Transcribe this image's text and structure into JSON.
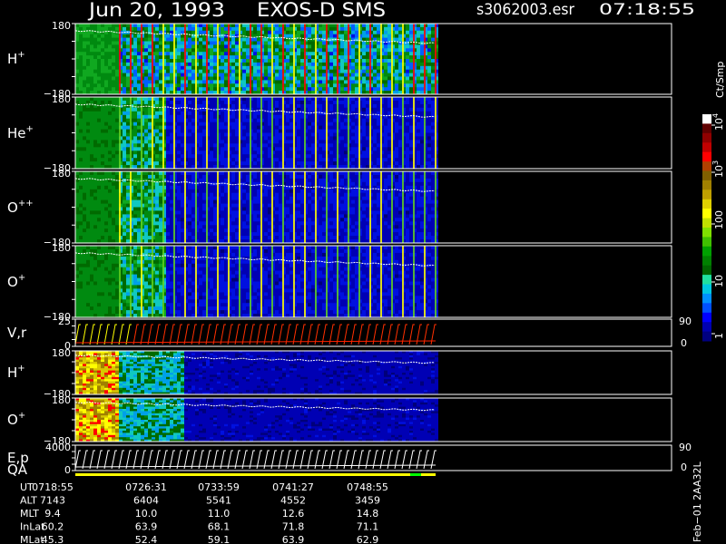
{
  "header": {
    "date": "Jun 20, 1993",
    "instrument": "EXOS-D SMS",
    "file": "s3062003.esr",
    "time": "07:18:55"
  },
  "colorbar": {
    "unit": "Ct/Smp",
    "ticks": [
      "1",
      "10",
      "100",
      "10",
      "10"
    ],
    "tick_exp": [
      "",
      "",
      "",
      "3",
      "4"
    ],
    "colors": [
      "#000080",
      "#0000b0",
      "#0000ff",
      "#0050ff",
      "#0090ff",
      "#00c8e0",
      "#20e0a0",
      "#006400",
      "#008000",
      "#00a000",
      "#40c000",
      "#80e000",
      "#c0e000",
      "#ffff00",
      "#e0d000",
      "#c0a000",
      "#a08000",
      "#806000",
      "#b04000",
      "#ff0000",
      "#c00000",
      "#900000",
      "#600000",
      "#ffffff"
    ]
  },
  "panels": [
    {
      "label": "H",
      "sup": "+",
      "top": "180",
      "bottom": "−180",
      "kind": "spectrogram",
      "mask": "H+"
    },
    {
      "label": "He",
      "sup": "+",
      "top": "180",
      "bottom": "−180",
      "kind": "spectrogram",
      "mask": "He+"
    },
    {
      "label": "O",
      "sup": "++",
      "top": "180",
      "bottom": "−180",
      "kind": "spectrogram",
      "mask": "O++"
    },
    {
      "label": "O",
      "sup": "+",
      "top": "180",
      "bottom": "−180",
      "kind": "spectrogram",
      "mask": "O+"
    },
    {
      "label": "V,r",
      "sup": "",
      "top": "25",
      "bottom": "0",
      "right_top": "90",
      "right_bottom": "0",
      "kind": "line"
    },
    {
      "label": "H",
      "sup": "+",
      "top": "180",
      "bottom": "−180",
      "kind": "spectrogram2"
    },
    {
      "label": "O",
      "sup": "+",
      "top": "180",
      "bottom": "−180",
      "kind": "spectrogram2"
    },
    {
      "label": "E,p",
      "label2": "QA",
      "top": "4000",
      "bottom": "0",
      "right_top": "90",
      "right_bottom": "0",
      "kind": "line"
    }
  ],
  "ephemeris": {
    "rows": [
      {
        "name": "UT",
        "values": [
          "0718:55",
          "0726:31",
          "0733:59",
          "0741:27",
          "0748:55"
        ]
      },
      {
        "name": "ALT",
        "values": [
          "7143",
          "6404",
          "5541",
          "4552",
          "3459"
        ]
      },
      {
        "name": "MLT",
        "values": [
          "9.4",
          "10.0",
          "11.0",
          "12.6",
          "14.8"
        ]
      },
      {
        "name": "InLat",
        "values": [
          "60.2",
          "63.9",
          "68.1",
          "71.8",
          "71.1"
        ]
      },
      {
        "name": "MLat",
        "values": [
          "45.3",
          "52.4",
          "59.1",
          "63.9",
          "62.9"
        ]
      }
    ]
  },
  "footer_version": "Feb−01 2AA32L",
  "chart_data": {
    "type": "heatmap",
    "title": "Jun 20, 1993   EXOS-D SMS",
    "x_ticks": [
      "0718:55",
      "0726:31",
      "0733:59",
      "0741:27",
      "0748:55"
    ],
    "panels": [
      "H+",
      "He+",
      "O++",
      "O+",
      "V,r",
      "H+",
      "O+",
      "E,p / QA"
    ],
    "y_range": [
      -180,
      180
    ],
    "colorbar_range": [
      1,
      10000
    ],
    "colorbar_log": true,
    "colorbar_label": "Ct/Smp"
  }
}
